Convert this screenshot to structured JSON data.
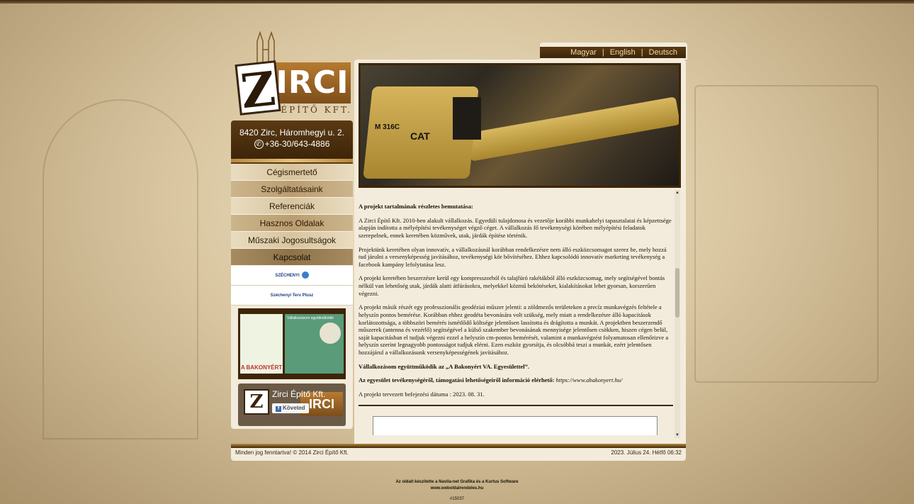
{
  "logo": {
    "initial": "Z",
    "name": "IRCI",
    "subtitle": "ÉPÍTŐ KFT."
  },
  "contact": {
    "address": "8420 Zirc, Háromhegyi u. 2.",
    "phone": "+36-30/643-4886"
  },
  "nav": [
    {
      "label": "Cégismertető"
    },
    {
      "label": "Szolgáltatásaink"
    },
    {
      "label": "Referenciák"
    },
    {
      "label": "Hasznos Oldalak"
    },
    {
      "label": "Műszaki Jogosultságok"
    },
    {
      "label": "Kapcsolat"
    }
  ],
  "sponsors": {
    "szechenyi": "SZÉCHENYI",
    "szechenyi_terv": "Széchenyi Terv Plusz"
  },
  "bakony": {
    "logo_text": "A BAKONYÉRT",
    "ad_title": "Vállalkozásom együttműködik"
  },
  "facebook": {
    "page_name": "Zirci Építő Kft.",
    "follow_label": "Követed",
    "banner": "IRCI"
  },
  "languages": [
    "Magyar",
    "English",
    "Deutsch"
  ],
  "hero": {
    "model": "M 316C",
    "brand": "CAT"
  },
  "content": {
    "heading": "A projekt tartalmának részletes bemutatása:",
    "p1": "A Zirci Építő Kft. 2010-ben alakult vállalkozás. Egyedüli tulajdonosa és vezetője korábbi munkahelyi tapasztalatai és képzettsége alapján indította a mélyépítési tevékenységet végző céget. A vállalkozás fő tevékenységi körében mélyépítési feladatok szerepelnek, ennek keretében közművek, utak, járdák építése történik.",
    "p2": "Projektünk keretében olyan innovatív, a vállalkozásnál korábban rendelkezésre nem álló eszközcsomagot szerez be, mely hozzá tud járulni a versenyképesség javításához, tevékenységi kör bővítéséhez. Ehhez kapcsolódó innovatív marketing tevékenység a facebook kampány lefolytatása lesz.",
    "p3": "A projekt keretében beszerzésre kerül egy kompresszorból és talajfúró rakétákból álló eszközcsomag, mely segítségével bontás nélkül van lehetőség utak, járdák alatti átfúrásokra, melyekkel közmű bekötéseket, kialakításokat lehet gyorsan, korszerűen végezni.",
    "p4": "A projekt másik részét egy professzionális geodéziai műszer jelenti: a zöldmezős területeken a precíz munkavégzés feltétele a helyszín pontos bemérése. Korábban ehhez geodéta bevonására volt szükség, mely miatt a rendelkezésre álló kapacitások korlátozottsága, a többszöri bemérés ismétlődő költsége jelentősen lassította és drágította a munkát. A projektben beszerzendő műszerek (antenna és vezérlő) segítségével a külső szakember bevonásának mennyisége jelentősen csökken, hiszen cégen belül, saját kapacitásban el tudjuk végezni ezzel a helyszín cm-pontos bemérését, valamint a munkavégzést folyamatosan ellenőrizve a helyszín szerint legnagyobb pontosságot tudjuk elérni. Ezen eszköz gyorsítja, és olcsóbbá teszi a munkát, ezért jelentősen hozzájárul a vállalkozásunk versenyképességének javításához.",
    "p5": "Vállalkozásom együttműködik az „A Bakonyért VA. Egyesülettel”.",
    "p6_label": "Az egyesület tevékenységéről, támogatási lehetőségeiről információ elérhető:",
    "p6_link": "https://www.abakonyert.hu/",
    "p7": "A projekt tervezett befejezési dátuma : 2023. 08. 31."
  },
  "footer": {
    "copyright": "Minden jog fenntartva! © 2014 Zirci Építő Kft.",
    "datetime": "2023. Július 24. Hétfő 06:32"
  },
  "credit": {
    "line1": "Az oldalt készítette a Navila-net Grafika és a Kurtus Software",
    "line2": "www.weboldalrendeles.hu",
    "line3": "#15037"
  }
}
